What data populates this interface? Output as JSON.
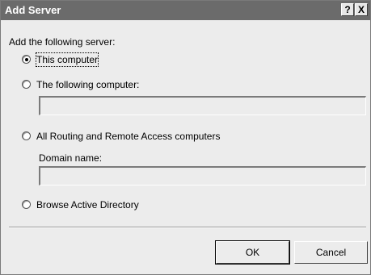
{
  "window": {
    "title": "Add Server",
    "help_glyph": "?",
    "close_glyph": "X"
  },
  "intro_text": "Add the following server:",
  "options": [
    {
      "label": "This computer",
      "checked": true
    },
    {
      "label": "The following computer:",
      "checked": false
    },
    {
      "label": "All Routing and Remote Access computers",
      "checked": false
    },
    {
      "label": "Browse Active Directory",
      "checked": false
    }
  ],
  "computer_field": {
    "value": ""
  },
  "domain_field": {
    "label": "Domain name:",
    "value": ""
  },
  "buttons": {
    "ok": "OK",
    "cancel": "Cancel"
  }
}
